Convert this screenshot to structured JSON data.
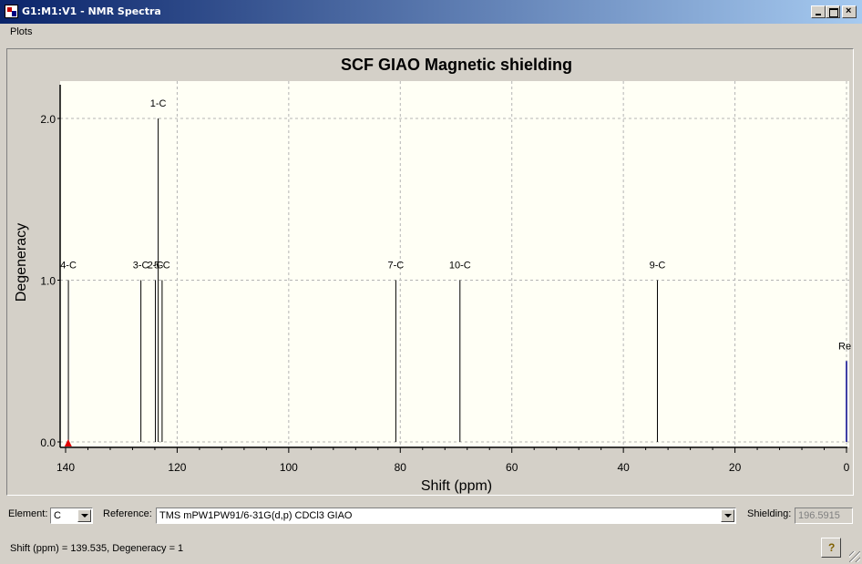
{
  "window": {
    "title": "G1:M1:V1 - NMR Spectra"
  },
  "menu": {
    "plots_label": "Plots"
  },
  "chart_data": {
    "type": "bar",
    "title": "SCF GIAO Magnetic shielding",
    "xlabel": "Shift (ppm)",
    "ylabel": "Degeneracy",
    "xlim": [
      140,
      0
    ],
    "ylim": [
      0,
      2.2
    ],
    "x_ticks": [
      140,
      120,
      100,
      80,
      60,
      40,
      20,
      0
    ],
    "y_ticks": [
      0.0,
      1.0,
      2.0
    ],
    "grid": true,
    "peaks": [
      {
        "label": "4-C",
        "shift": 139.5,
        "degeneracy": 1
      },
      {
        "label": "3-C",
        "shift": 126.5,
        "degeneracy": 1
      },
      {
        "label": "1-C",
        "shift": 123.4,
        "degeneracy": 2
      },
      {
        "label": "2-C",
        "shift": 123.9,
        "degeneracy": 1
      },
      {
        "label": "5-C",
        "shift": 122.7,
        "degeneracy": 1
      },
      {
        "label": "7-C",
        "shift": 80.8,
        "degeneracy": 1
      },
      {
        "label": "10-C",
        "shift": 69.3,
        "degeneracy": 1
      },
      {
        "label": "9-C",
        "shift": 33.9,
        "degeneracy": 1
      }
    ],
    "reference_line": {
      "label": "Re",
      "shift": 0.0,
      "degeneracy": 0.5
    },
    "selected_shift": 139.535,
    "colors": {
      "plot_bg": "#fffff5",
      "peak": "#000000",
      "reference": "#00008b",
      "marker": "#e00000"
    }
  },
  "controls": {
    "element_label": "Element:",
    "element_value": "C",
    "reference_label": "Reference:",
    "reference_value": "TMS mPW1PW91/6-31G(d,p) CDCl3 GIAO",
    "shielding_label": "Shielding:",
    "shielding_value": "196.5915"
  },
  "status": {
    "text": "Shift (ppm) = 139.535, Degeneracy = 1",
    "help_label": "?"
  }
}
